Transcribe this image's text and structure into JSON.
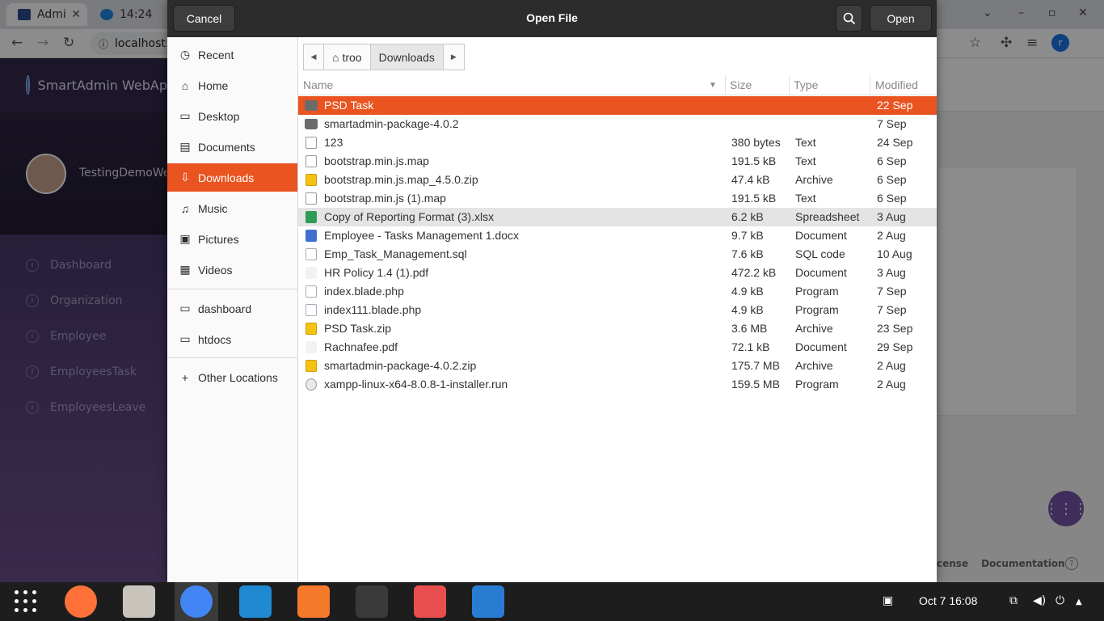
{
  "browser": {
    "tabs": [
      {
        "label": "Admi",
        "favicon_color": "#2c4b8f"
      },
      {
        "label": "14:24",
        "favicon_color": "#1e88e5"
      }
    ],
    "url": "localhost:",
    "profile_initial": "r"
  },
  "webapp": {
    "brand": "SmartAdmin WebAp",
    "user_name": "TestingDemoWe...",
    "menu": [
      {
        "label": "Dashboard"
      },
      {
        "label": "Organization"
      },
      {
        "label": "Employee"
      },
      {
        "label": "EmployeesTask"
      },
      {
        "label": "EmployeesLeave"
      }
    ],
    "footer": {
      "license": "cense",
      "documentation": "Documentation"
    }
  },
  "dialog": {
    "title": "Open File",
    "cancel_label": "Cancel",
    "open_label": "Open",
    "places": [
      {
        "label": "Recent",
        "icon": "clock-icon"
      },
      {
        "label": "Home",
        "icon": "home-icon"
      },
      {
        "label": "Desktop",
        "icon": "desktop-icon"
      },
      {
        "label": "Documents",
        "icon": "documents-icon"
      },
      {
        "label": "Downloads",
        "icon": "download-icon",
        "active": true
      },
      {
        "label": "Music",
        "icon": "music-icon"
      },
      {
        "label": "Pictures",
        "icon": "pictures-icon"
      },
      {
        "label": "Videos",
        "icon": "videos-icon"
      }
    ],
    "bookmarks": [
      {
        "label": "dashboard",
        "icon": "folder-icon"
      },
      {
        "label": "htdocs",
        "icon": "folder-icon"
      }
    ],
    "other_locations": "Other Locations",
    "path": {
      "home": "troo",
      "current": "Downloads"
    },
    "columns": {
      "name": "Name",
      "size": "Size",
      "type": "Type",
      "modified": "Modified"
    },
    "files": [
      {
        "name": "PSD Task",
        "size": "",
        "type": "",
        "modified": "22 Sep",
        "icon": "folder"
      },
      {
        "name": "smartadmin-package-4.0.2",
        "size": "",
        "type": "",
        "modified": "7 Sep",
        "icon": "folder"
      },
      {
        "name": "123",
        "size": "380 bytes",
        "type": "Text",
        "modified": "24 Sep",
        "icon": "text"
      },
      {
        "name": "bootstrap.min.js.map",
        "size": "191.5 kB",
        "type": "Text",
        "modified": "6 Sep",
        "icon": "text"
      },
      {
        "name": "bootstrap.min.js.map_4.5.0.zip",
        "size": "47.4 kB",
        "type": "Archive",
        "modified": "6 Sep",
        "icon": "archive"
      },
      {
        "name": "bootstrap.min.js (1).map",
        "size": "191.5 kB",
        "type": "Text",
        "modified": "6 Sep",
        "icon": "text"
      },
      {
        "name": "Copy of Reporting Format (3).xlsx",
        "size": "6.2 kB",
        "type": "Spreadsheet",
        "modified": "3 Aug",
        "icon": "sheet"
      },
      {
        "name": "Employee - Tasks Management 1.docx",
        "size": "9.7 kB",
        "type": "Document",
        "modified": "2 Aug",
        "icon": "doc"
      },
      {
        "name": "Emp_Task_Management.sql",
        "size": "7.6 kB",
        "type": "SQL code",
        "modified": "10 Aug",
        "icon": "code"
      },
      {
        "name": "HR Policy 1.4 (1).pdf",
        "size": "472.2 kB",
        "type": "Document",
        "modified": "3 Aug",
        "icon": "pdf"
      },
      {
        "name": "index.blade.php",
        "size": "4.9 kB",
        "type": "Program",
        "modified": "7 Sep",
        "icon": "prog"
      },
      {
        "name": "index111.blade.php",
        "size": "4.9 kB",
        "type": "Program",
        "modified": "7 Sep",
        "icon": "prog"
      },
      {
        "name": "PSD Task.zip",
        "size": "3.6 MB",
        "type": "Archive",
        "modified": "23 Sep",
        "icon": "archive"
      },
      {
        "name": "Rachnafee.pdf",
        "size": "72.1 kB",
        "type": "Document",
        "modified": "29 Sep",
        "icon": "pdf"
      },
      {
        "name": "smartadmin-package-4.0.2.zip",
        "size": "175.7 MB",
        "type": "Archive",
        "modified": "2 Aug",
        "icon": "archive"
      },
      {
        "name": "xampp-linux-x64-8.0.8-1-installer.run",
        "size": "159.5 MB",
        "type": "Program",
        "modified": "2 Aug",
        "icon": "run"
      }
    ],
    "selected_index": 0,
    "hover_index": 6
  },
  "taskbar": {
    "apps": [
      {
        "name": "firefox",
        "color": "#ff7139"
      },
      {
        "name": "files",
        "color": "#c8c4bc"
      },
      {
        "name": "chrome",
        "color": "#4285f4"
      },
      {
        "name": "vscode",
        "color": "#1f8ad2"
      },
      {
        "name": "blender",
        "color": "#f5792a"
      },
      {
        "name": "terminal",
        "color": "#3a3a3a"
      },
      {
        "name": "screenshot",
        "color": "#e84e4e"
      },
      {
        "name": "writer",
        "color": "#2a7cd3"
      }
    ],
    "clock": "Oct 7  16:08"
  },
  "colors": {
    "accent": "#e95420",
    "header": "#2c2c2c"
  }
}
